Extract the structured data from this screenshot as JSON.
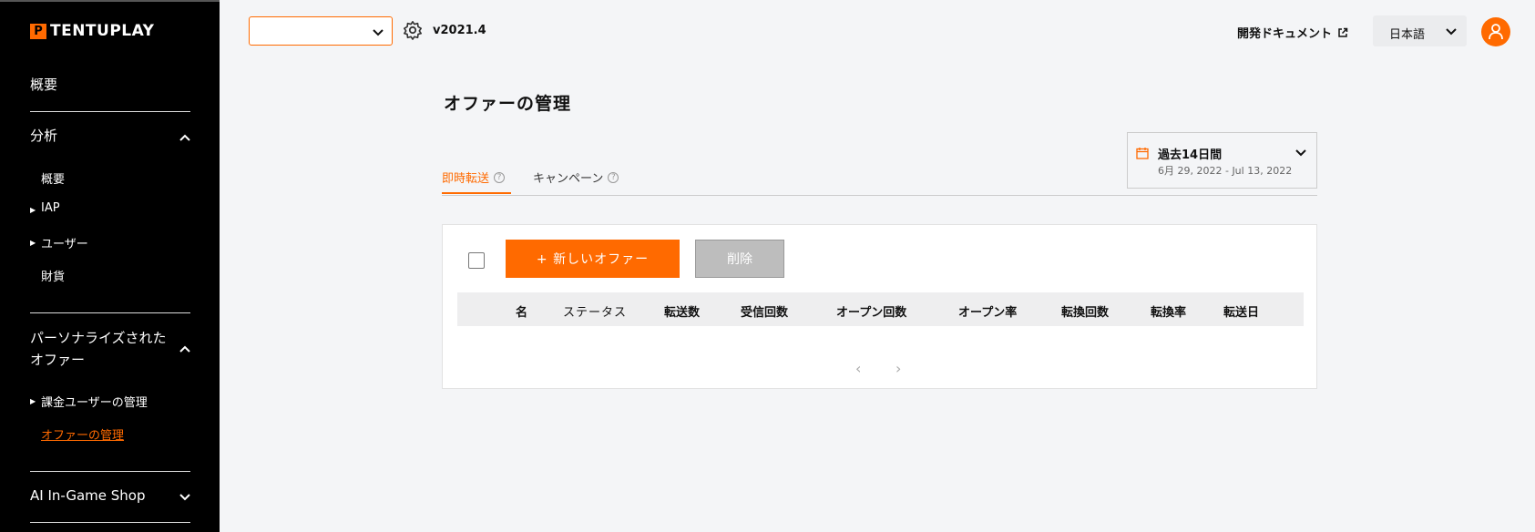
{
  "brand": {
    "logo_mark": "P",
    "logo_text": "TENTUPLAY"
  },
  "sidebar": {
    "overview": "概要",
    "analytics": {
      "label": "分析",
      "items": [
        "概要",
        "IAP",
        "ユーザー",
        "財貨"
      ]
    },
    "personalized": {
      "label_line1": "パーソナライズされた",
      "label_line2": "オファー",
      "items": [
        "課金ユーザーの管理",
        "オファーの管理"
      ]
    },
    "ai_shop": "AI In-Game Shop"
  },
  "topbar": {
    "app_select_value": "",
    "version": "v2021.4",
    "doc_link": "開発ドキュメント",
    "language": "日本語"
  },
  "main": {
    "title": "オファーの管理",
    "tabs": [
      {
        "label": "即時転送",
        "active": true
      },
      {
        "label": "キャンペーン",
        "active": false
      }
    ],
    "tab_help": "?",
    "date_filter": {
      "label": "過去14日間",
      "range": "6月 29, 2022 - Jul 13, 2022"
    },
    "new_offer_button": "+ 新しいオファー",
    "delete_button": "削除",
    "columns": [
      "名",
      "ステータス",
      "転送数",
      "受信回数",
      "オープン回数",
      "オープン率",
      "転換回数",
      "転換率",
      "転送日"
    ],
    "pager_prev": "‹",
    "pager_next": "›"
  },
  "colors": {
    "accent": "#ff6a00",
    "sidebar_bg": "#000000",
    "page_bg": "#f4f5f7"
  }
}
